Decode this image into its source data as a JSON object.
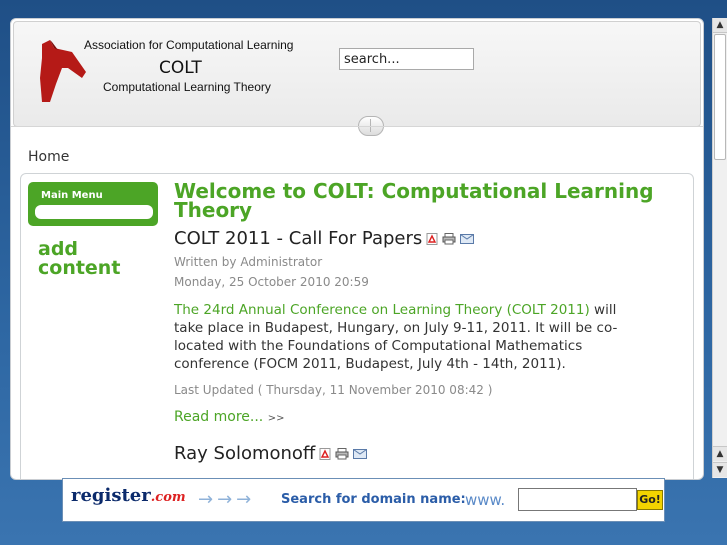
{
  "header": {
    "org_name": "Association for Computational Learning",
    "site_name": "COLT",
    "slogan": "Computational Learning Theory",
    "search_placeholder": "search..."
  },
  "breadcrumb": "Home",
  "sidebar": {
    "menu_title": "Main Menu",
    "add_content": "add content"
  },
  "main": {
    "page_title": "Welcome to COLT: Computational Learning Theory",
    "article1": {
      "title": "COLT 2011 - Call For Papers",
      "author": "Written by Administrator",
      "date": "Monday, 25 October 2010 20:59",
      "link_text": "The 24rd Annual Conference on Learning Theory (COLT 2011)",
      "body": " will take place in Budapest, Hungary, on July 9-11, 2011. It will be co-located with the Foundations of Computational Mathematics conference (FOCM 2011, Budapest, July 4th - 14th, 2011).",
      "updated": "Last Updated ( Thursday, 11 November 2010 08:42 )",
      "read_more": "Read more...",
      "read_more_arrow": ">>"
    },
    "article2": {
      "title": "Ray Solomonoff"
    }
  },
  "icons": [
    "pdf-icon",
    "print-icon",
    "email-icon",
    "horse-logo-icon"
  ],
  "colors": {
    "accent_green": "#4ca526",
    "background_blue": "#2d5f94"
  },
  "ad": {
    "brand": "register",
    "brand_tld": ".com",
    "prompt": "Search for domain name:",
    "www": "www.",
    "go": "Go!"
  }
}
